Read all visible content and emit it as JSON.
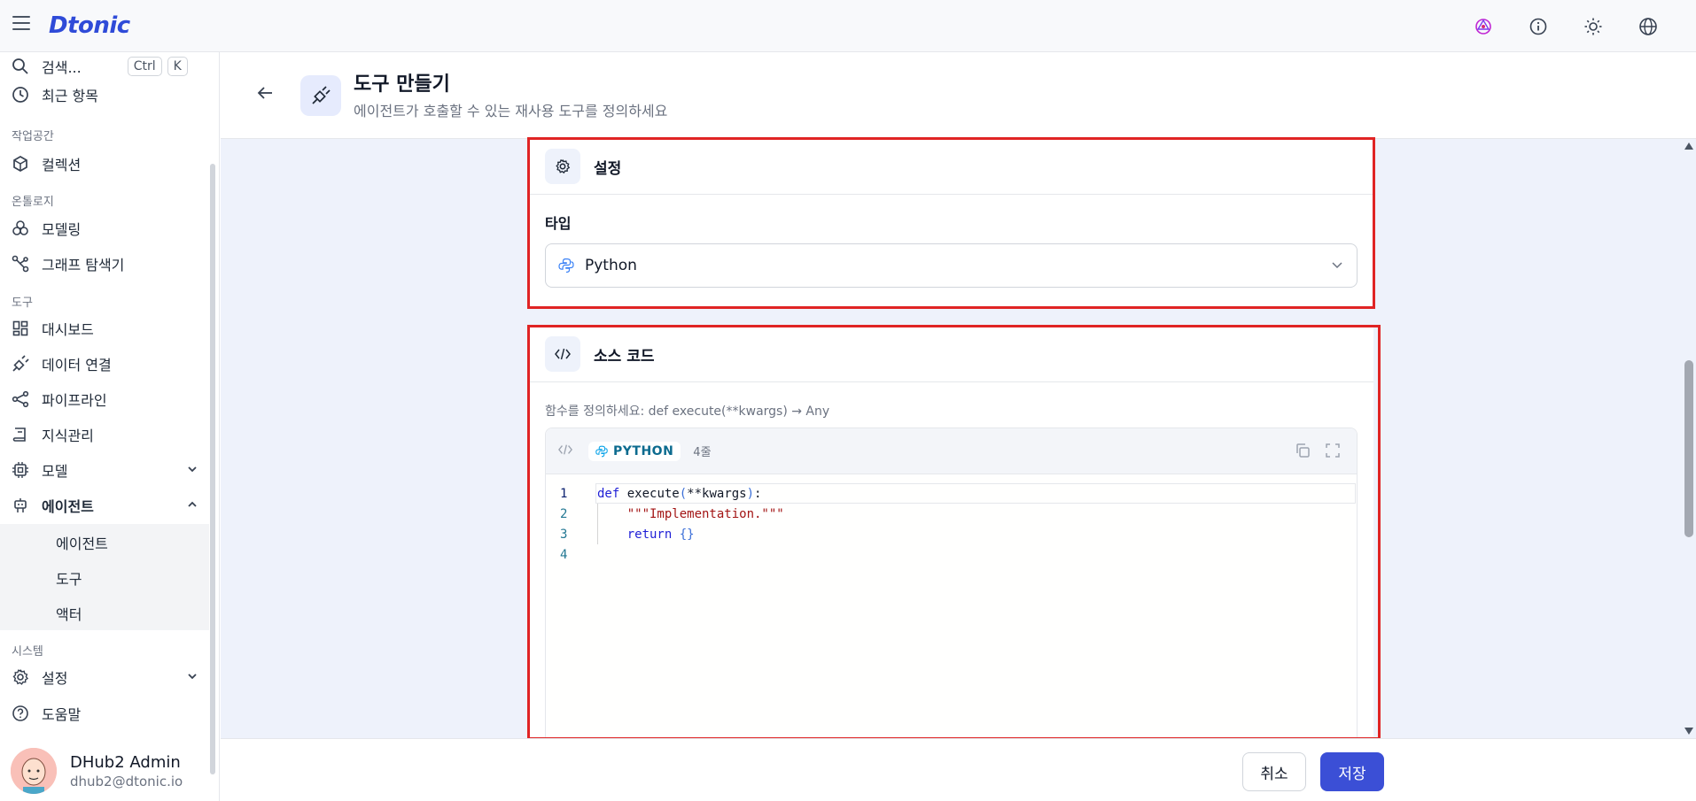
{
  "app": {
    "logo_text": "Dtonic"
  },
  "sidebar": {
    "search_label": "검색...",
    "search_shortcut": [
      "Ctrl",
      "K"
    ],
    "recent_label": "최근 항목",
    "section_workspace": "작업공간",
    "collection_label": "컬렉션",
    "section_ontology": "온톨로지",
    "modeling_label": "모델링",
    "graph_explorer_label": "그래프 탐색기",
    "section_tools": "도구",
    "dashboard_label": "대시보드",
    "data_connect_label": "데이터 연결",
    "pipeline_label": "파이프라인",
    "knowledge_label": "지식관리",
    "model_label": "모델",
    "agent_label": "에이전트",
    "agent_sub": [
      "에이전트",
      "도구",
      "액터"
    ],
    "section_system": "시스템",
    "settings_label": "설정",
    "help_label": "도움말"
  },
  "user": {
    "name": "DHub2 Admin",
    "email": "dhub2@dtonic.io"
  },
  "header": {
    "title": "도구 만들기",
    "subtitle": "에이전트가 호출할 수 있는 재사용 도구를 정의하세요"
  },
  "settings_card": {
    "title": "설정",
    "type_label": "타입",
    "type_value": "Python"
  },
  "source_card": {
    "title": "소스 코드",
    "hint": "함수를 정의하세요: def execute(**kwargs) → Any",
    "language": "PYTHON",
    "line_count": "4줄",
    "line_numbers": [
      "1",
      "2",
      "3",
      "4"
    ]
  },
  "footer": {
    "cancel_label": "취소",
    "save_label": "저장"
  },
  "colors": {
    "accent": "#3b4fd6",
    "highlight": "#e02424",
    "main_bg": "#eef2fb"
  }
}
